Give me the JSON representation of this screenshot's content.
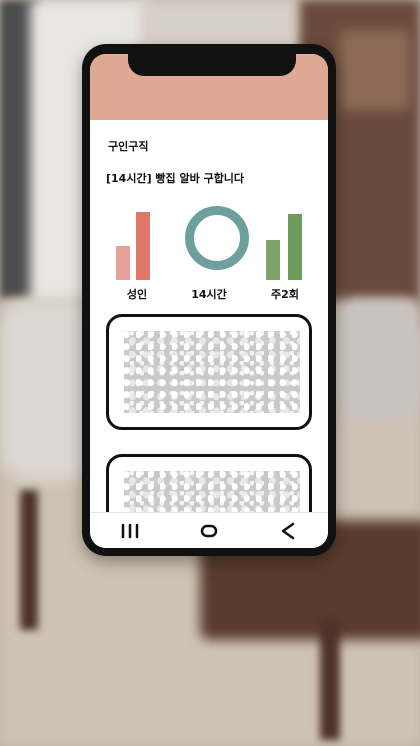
{
  "app": {
    "category": "구인구직",
    "headline": "[14시간] 빵집 알바 구합니다"
  },
  "stats": [
    {
      "label": "성인",
      "icon": "bar-chart-icon",
      "colors": [
        "#e3a197",
        "#e0786a"
      ]
    },
    {
      "label": "14시간",
      "icon": "ring-icon",
      "colors": [
        "#6d9f9d"
      ]
    },
    {
      "label": "주2회",
      "icon": "bar-chart-icon",
      "colors": [
        "#7da36a",
        "#6d9b59"
      ]
    }
  ],
  "cards": [
    {
      "name": "listing-card-1",
      "image": "blurred-image-placeholder"
    },
    {
      "name": "listing-card-2",
      "image": "blurred-image-placeholder"
    }
  ],
  "navbar": {
    "buttons": [
      {
        "icon": "recent-apps-icon"
      },
      {
        "icon": "home-icon"
      },
      {
        "icon": "back-icon"
      }
    ]
  },
  "colors": {
    "header": "#dea894",
    "accent_teal": "#6d9f9d",
    "accent_red": "#e0786a",
    "accent_green": "#6d9b59"
  }
}
